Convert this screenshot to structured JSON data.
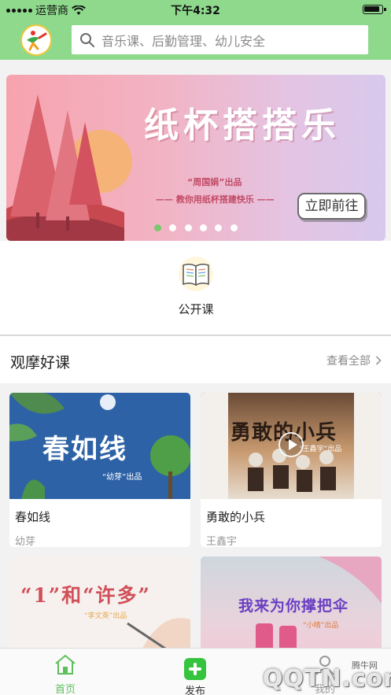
{
  "status_bar": {
    "carrier": "运营商",
    "time": "下午4:32"
  },
  "search": {
    "placeholder": "音乐课、后勤管理、幼儿安全"
  },
  "banner": {
    "title": "纸杯搭搭乐",
    "subtitle_producer": "“周国娟”出品",
    "subtitle_desc": "—— 教你用纸杯搭建快乐 ——",
    "button_label": "立即前往",
    "page_count": 6,
    "active_page": 1
  },
  "entry": {
    "label": "公开课"
  },
  "section": {
    "title": "观摩好课",
    "more_label": "查看全部"
  },
  "cards": [
    {
      "title": "春如线",
      "author": "幼芽",
      "thumb_text": "春如线",
      "thumb_sub": "“幼芽”出品"
    },
    {
      "title": "勇敢的小兵",
      "author": "王鑫宇",
      "thumb_text": "勇敢的小兵",
      "thumb_sub": "“王鑫宇”出品"
    },
    {
      "thumb_text": "“1”和“许多”",
      "thumb_sub": "“李文英”出品"
    },
    {
      "thumb_text": "我来为你撑把伞",
      "thumb_sub": "“小晴”出品"
    }
  ],
  "tabbar": {
    "home": "首页",
    "publish": "发布",
    "me": "我的"
  },
  "watermark": {
    "small": "腾牛网",
    "big": "QQTN.com"
  },
  "colors": {
    "header": "#8fd98d",
    "accent_green": "#5cbf5a",
    "publish_green": "#36c43e"
  },
  "icons": [
    "wifi-icon",
    "battery-icon",
    "search-icon",
    "book-icon",
    "chevron-right-icon",
    "home-icon",
    "plus-icon",
    "user-icon",
    "play-icon"
  ]
}
